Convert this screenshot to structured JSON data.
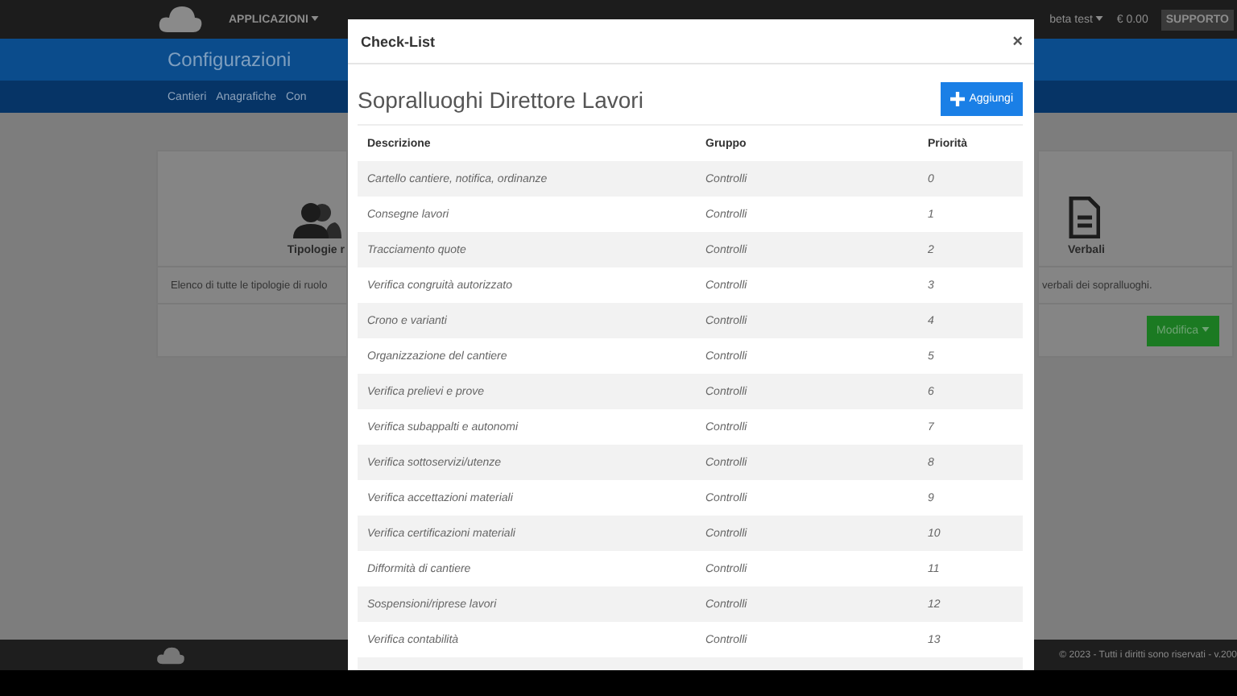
{
  "topbar": {
    "menu": "APPLICAZIONI",
    "user": "beta test",
    "balance": "€ 0.00",
    "support": "SUPPORTO"
  },
  "header": {
    "title": "Configurazioni"
  },
  "subnav": [
    "Cantieri",
    "Anagrafiche",
    "Con"
  ],
  "cards": [
    {
      "title": "Tipologie r",
      "description": "Elenco di tutte le tipologie di ruolo"
    },
    {
      "title": "Verbali",
      "description": "verbali dei sopralluoghi.",
      "button": "Modifica"
    }
  ],
  "footer": {
    "text": "© 2023 - Tutti i diritti sono riservati - v.200"
  },
  "modal": {
    "title": "Check-List",
    "close": "×",
    "heading": "Sopralluoghi Direttore Lavori",
    "add_button": "Aggiungi",
    "table": {
      "columns": [
        "Descrizione",
        "Gruppo",
        "Priorità"
      ],
      "rows": [
        [
          "Cartello cantiere, notifica, ordinanze",
          "Controlli",
          "0"
        ],
        [
          "Consegne lavori",
          "Controlli",
          "1"
        ],
        [
          "Tracciamento quote",
          "Controlli",
          "2"
        ],
        [
          "Verifica congruità autorizzato",
          "Controlli",
          "3"
        ],
        [
          "Crono e varianti",
          "Controlli",
          "4"
        ],
        [
          "Organizzazione del cantiere",
          "Controlli",
          "5"
        ],
        [
          "Verifica prelievi e prove",
          "Controlli",
          "6"
        ],
        [
          "Verifica subappalti e autonomi",
          "Controlli",
          "7"
        ],
        [
          "Verifica sottoservizi/utenze",
          "Controlli",
          "8"
        ],
        [
          "Verifica accettazioni materiali",
          "Controlli",
          "9"
        ],
        [
          "Verifica certificazioni materiali",
          "Controlli",
          "10"
        ],
        [
          "Difformità di cantiere",
          "Controlli",
          "11"
        ],
        [
          "Sospensioni/riprese lavori",
          "Controlli",
          "12"
        ],
        [
          "Verifica contabilità",
          "Controlli",
          "13"
        ]
      ]
    }
  }
}
